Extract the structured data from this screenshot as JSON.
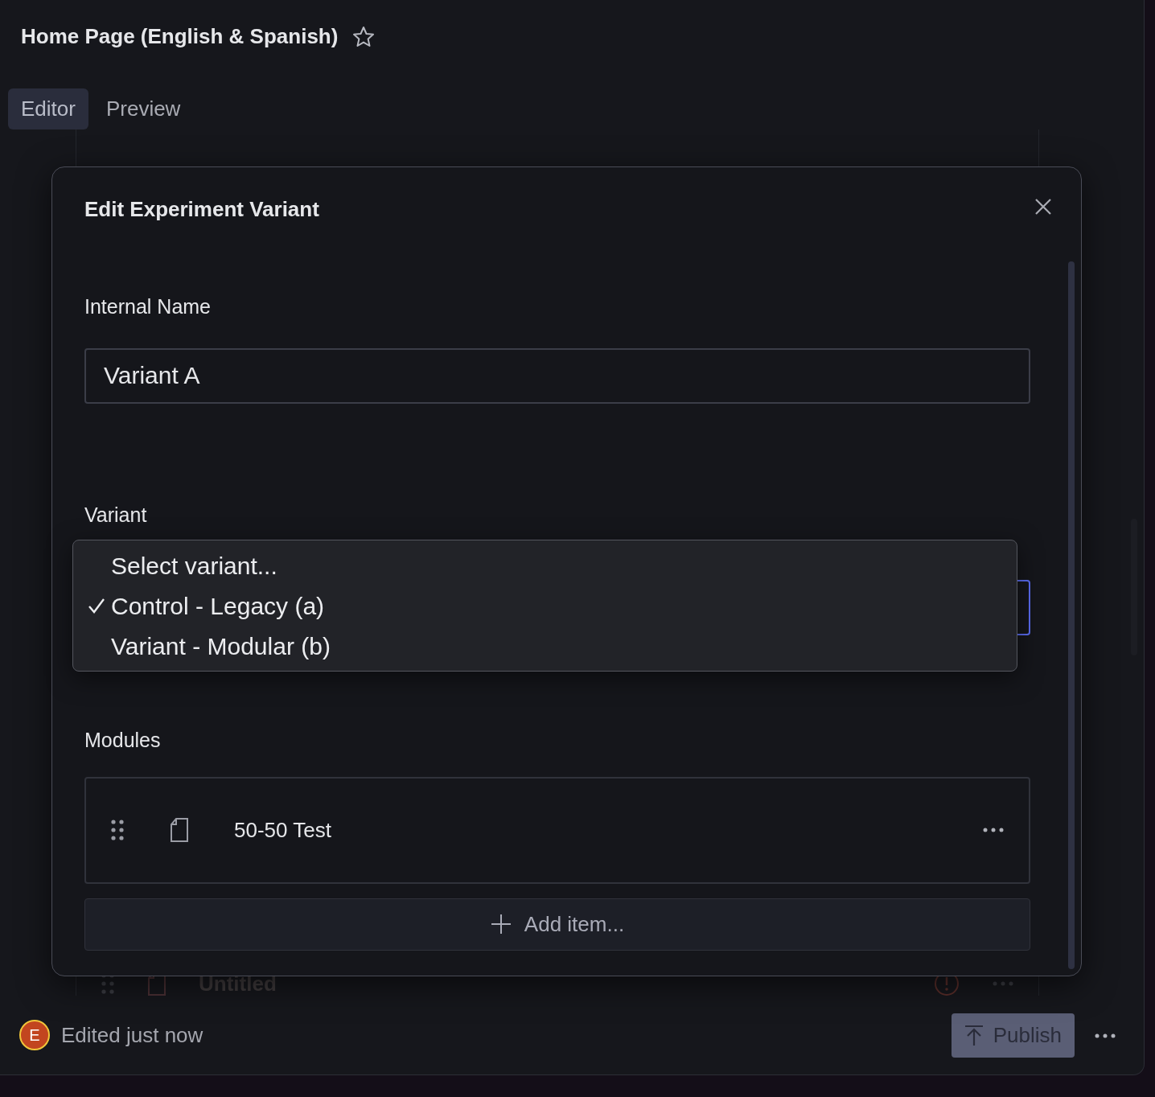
{
  "page": {
    "title": "Home Page (English & Spanish)",
    "starred": false
  },
  "tabs": [
    {
      "label": "Editor",
      "selected": true
    },
    {
      "label": "Preview",
      "selected": false
    }
  ],
  "background_rows": [
    {
      "title": "Untitled",
      "warning": true
    }
  ],
  "dialog": {
    "title": "Edit Experiment Variant",
    "internal_name": {
      "label": "Internal Name",
      "value": "Variant A"
    },
    "variant": {
      "label": "Variant",
      "options": [
        {
          "label": "Select variant...",
          "selected": false
        },
        {
          "label": "Control - Legacy (a)",
          "selected": true
        },
        {
          "label": "Variant - Modular (b)",
          "selected": false
        }
      ]
    },
    "modules": {
      "label": "Modules",
      "items": [
        {
          "title": "50-50 Test"
        }
      ],
      "add_label": "Add item..."
    }
  },
  "footer": {
    "avatar_initial": "E",
    "status": "Edited just now",
    "publish_label": "Publish"
  }
}
